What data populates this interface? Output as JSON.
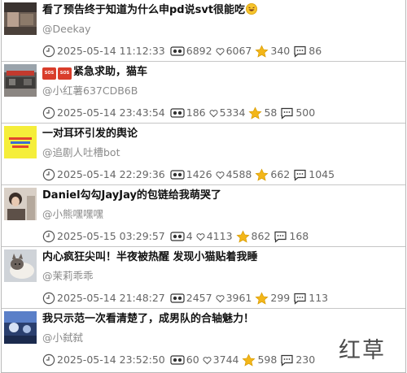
{
  "posts": [
    {
      "title": "看了预告终于知道为什么申pd说svt很能吃",
      "title_emoji": "rofl-emoji",
      "author": "@Deekay",
      "timestamp": "2025-05-14 11:12:33",
      "views": "6892",
      "likes": "6067",
      "stars": "340",
      "comments": "86",
      "thumb_icon": "video-thumbnail-dark"
    },
    {
      "title": "紧急求助，猫车",
      "title_prefix_icons": [
        "sos-icon",
        "sos-icon"
      ],
      "sos_text": "SOS",
      "author": "@小红薯637CDB6B",
      "timestamp": "2025-05-14 23:43:54",
      "views": "186",
      "likes": "5334",
      "stars": "58",
      "comments": "500",
      "thumb_icon": "video-thumbnail-street"
    },
    {
      "title": "一对耳环引发的舆论",
      "author": "@追剧人吐槽bot",
      "timestamp": "2025-05-14 22:29:36",
      "views": "1426",
      "likes": "4588",
      "stars": "662",
      "comments": "1045",
      "thumb_icon": "video-thumbnail-yellow"
    },
    {
      "title": "Daniel勾勾JayJay的包链给我萌哭了",
      "author": "@小熊嘿嘿嘿",
      "timestamp": "2025-05-15 03:29:57",
      "views": "4",
      "likes": "4113",
      "stars": "862",
      "comments": "168",
      "thumb_icon": "video-thumbnail-person"
    },
    {
      "title": "内心疯狂尖叫！半夜被热醒 发现小猫贴着我睡",
      "author": "@茉莉乖乖",
      "timestamp": "2025-05-14 21:48:27",
      "views": "2457",
      "likes": "3961",
      "stars": "299",
      "comments": "113",
      "thumb_icon": "video-thumbnail-cat"
    },
    {
      "title": "我只示范一次看清楚了，成男队的合轴魅力！",
      "author": "@小弑弑",
      "timestamp": "2025-05-14 23:52:50",
      "views": "60",
      "likes": "3744",
      "stars": "598",
      "comments": "230",
      "thumb_icon": "video-thumbnail-blue"
    }
  ],
  "watermark": "红草",
  "colors": {
    "star": "#f3b619",
    "sos": "#d93d2b",
    "divider": "#c6c6c6",
    "author": "#8a8a8a",
    "meta": "#666666"
  }
}
